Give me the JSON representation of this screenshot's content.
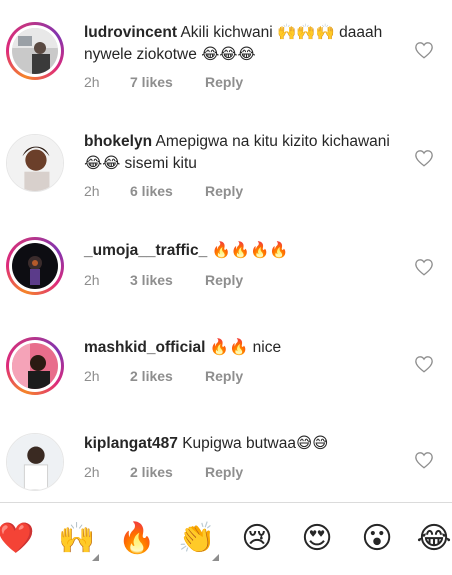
{
  "comments": [
    {
      "username": "ludrovincent",
      "text": "Akili kichwani 🙌🙌🙌 daaah nywele ziokotwe 😂😂😂",
      "time": "2h",
      "likes": "7 likes",
      "reply": "Reply",
      "liked": false
    },
    {
      "username": "bhokelyn",
      "text": "Amepigwa na kitu kizito kichawani 😂😂 sisemi kitu",
      "time": "2h",
      "likes": "6 likes",
      "reply": "Reply",
      "liked": false
    },
    {
      "username": "_umoja__traffic_",
      "text": "🔥🔥🔥🔥",
      "time": "2h",
      "likes": "3 likes",
      "reply": "Reply",
      "liked": false
    },
    {
      "username": "mashkid_official",
      "text": "🔥🔥 nice",
      "time": "2h",
      "likes": "2 likes",
      "reply": "Reply",
      "liked": false
    },
    {
      "username": "kiplangat487",
      "text": "Kupigwa butwaa😅😅",
      "time": "2h",
      "likes": "2 likes",
      "reply": "Reply",
      "liked": false
    }
  ],
  "reaction_bar": {
    "items": [
      {
        "emoji": "❤️",
        "name": "red-heart"
      },
      {
        "emoji": "🙌",
        "name": "raising-hands"
      },
      {
        "emoji": "🔥",
        "name": "fire"
      },
      {
        "emoji": "👏",
        "name": "clapping-hands"
      },
      {
        "emoji": "😢",
        "name": "crying-face"
      },
      {
        "emoji": "😍",
        "name": "heart-eyes"
      },
      {
        "emoji": "😮",
        "name": "surprised-face"
      },
      {
        "emoji": "😂",
        "name": "tears-of-joy"
      }
    ]
  },
  "colors": {
    "text": "#262626",
    "muted": "#8e8e8e",
    "ring_start": "#f58529",
    "ring_end": "#8134af"
  }
}
